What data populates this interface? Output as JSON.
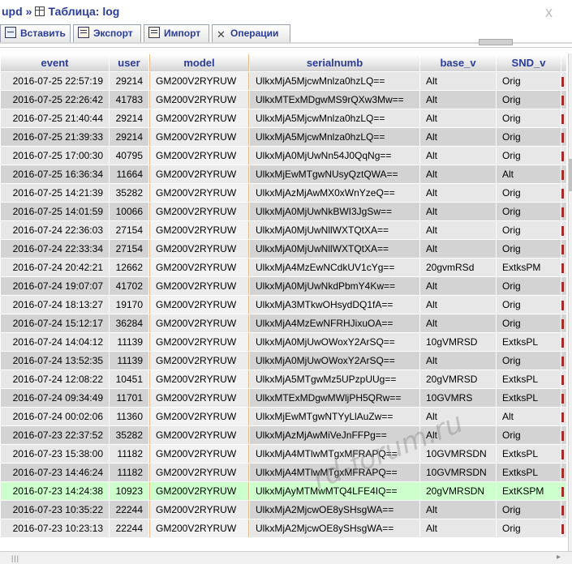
{
  "breadcrumb": {
    "db": "upd",
    "separator": "»",
    "table": "Таблица: log",
    "close": "x"
  },
  "tabs": [
    {
      "label": "Вставить",
      "icon": "insert-icon"
    },
    {
      "label": "Экспорт",
      "icon": "export-icon"
    },
    {
      "label": "Импорт",
      "icon": "import-icon"
    },
    {
      "label": "Операции",
      "icon": "operations-icon"
    }
  ],
  "table": {
    "columns": [
      "event",
      "user",
      "model",
      "serialnumb",
      "base_v",
      "SND_v"
    ],
    "rows": [
      [
        "2016-07-25 22:57:19",
        "29214",
        "GM200V2RYRUW",
        "UlkxMjA5MjcwMnlza0hzLQ==",
        "Alt",
        "Orig"
      ],
      [
        "2016-07-25 22:26:42",
        "41783",
        "GM200V2RYRUW",
        "UlkxMTExMDgwMS9rQXw3Mw==",
        "Alt",
        "Orig"
      ],
      [
        "2016-07-25 21:40:44",
        "29214",
        "GM200V2RYRUW",
        "UlkxMjA5MjcwMnlza0hzLQ==",
        "Alt",
        "Orig"
      ],
      [
        "2016-07-25 21:39:33",
        "29214",
        "GM200V2RYRUW",
        "UlkxMjA5MjcwMnlza0hzLQ==",
        "Alt",
        "Orig"
      ],
      [
        "2016-07-25 17:00:30",
        "40795",
        "GM200V2RYRUW",
        "UlkxMjA0MjUwNn54J0QqNg==",
        "Alt",
        "Orig"
      ],
      [
        "2016-07-25 16:36:34",
        "11664",
        "GM200V2RYRUW",
        "UlkxMjEwMTgwNUsyQztQWA==",
        "Alt",
        "Alt"
      ],
      [
        "2016-07-25 14:21:39",
        "35282",
        "GM200V2RYRUW",
        "UlkxMjAzMjAwMX0xWnYzeQ==",
        "Alt",
        "Orig"
      ],
      [
        "2016-07-25 14:01:59",
        "10066",
        "GM200V2RYRUW",
        "UlkxMjA0MjUwNkBWI3JgSw==",
        "Alt",
        "Orig"
      ],
      [
        "2016-07-24 22:36:03",
        "27154",
        "GM200V2RYRUW",
        "UlkxMjA0MjUwNllWXTQtXA==",
        "Alt",
        "Orig"
      ],
      [
        "2016-07-24 22:33:34",
        "27154",
        "GM200V2RYRUW",
        "UlkxMjA0MjUwNllWXTQtXA==",
        "Alt",
        "Orig"
      ],
      [
        "2016-07-24 20:42:21",
        "12662",
        "GM200V2RYRUW",
        "UlkxMjA4MzEwNCdkUV1cYg==",
        "20gvmRSd",
        "ExtksPM"
      ],
      [
        "2016-07-24 19:07:07",
        "41702",
        "GM200V2RYRUW",
        "UlkxMjA0MjUwNkdPbmY4Kw==",
        "Alt",
        "Orig"
      ],
      [
        "2016-07-24 18:13:27",
        "19170",
        "GM200V2RYRUW",
        "UlkxMjA3MTkwOHsydDQ1fA==",
        "Alt",
        "Orig"
      ],
      [
        "2016-07-24 15:12:17",
        "36284",
        "GM200V2RYRUW",
        "UlkxMjA4MzEwNFRHJixuOA==",
        "Alt",
        "Orig"
      ],
      [
        "2016-07-24 14:04:12",
        "11139",
        "GM200V2RYRUW",
        "UlkxMjA0MjUwOWoxY2ArSQ==",
        "10gVMRSD",
        "ExtksPL"
      ],
      [
        "2016-07-24 13:52:35",
        "11139",
        "GM200V2RYRUW",
        "UlkxMjA0MjUwOWoxY2ArSQ==",
        "Alt",
        "Orig"
      ],
      [
        "2016-07-24 12:08:22",
        "10451",
        "GM200V2RYRUW",
        "UlkxMjA5MTgwMz5UPzpUUg==",
        "20gVMRSD",
        "ExtksPL"
      ],
      [
        "2016-07-24 09:34:49",
        "11701",
        "GM200V2RYRUW",
        "UlkxMTExMDgwMWljPH5QRw==",
        "10GVMRS",
        "ExtksPL"
      ],
      [
        "2016-07-24 00:02:06",
        "11360",
        "GM200V2RYRUW",
        "UlkxMjEwMTgwNTYyLlAuZw==",
        "Alt",
        "Alt"
      ],
      [
        "2016-07-23 22:37:52",
        "35282",
        "GM200V2RYRUW",
        "UlkxMjAzMjAwMiVeJnFFPg==",
        "Alt",
        "Orig"
      ],
      [
        "2016-07-23 15:38:00",
        "11182",
        "GM200V2RYRUW",
        "UlkxMjA4MTlwMTgxMFRAPQ==",
        "10GVMRSDN",
        "ExtksPL"
      ],
      [
        "2016-07-23 14:46:24",
        "11182",
        "GM200V2RYRUW",
        "UlkxMjA4MTlwMTgxMFRAPQ==",
        "10GVMRSDN",
        "ExtksPL"
      ],
      [
        "2016-07-23 14:24:38",
        "10923",
        "GM200V2RYRUW",
        "UlkxMjAyMTMwMTQ4LFE4IQ==",
        "20gVMRSDN",
        "ExtKSPM"
      ],
      [
        "2016-07-23 10:35:22",
        "22244",
        "GM200V2RYRUW",
        "UlkxMjA2MjcwOE8ySHsgWA==",
        "Alt",
        "Orig"
      ],
      [
        "2016-07-23 10:23:13",
        "22244",
        "GM200V2RYRUW",
        "UlkxMjA2MjcwOE8ySHsgWA==",
        "Alt",
        "Orig"
      ]
    ],
    "highlighted_row": 22
  },
  "watermark": "rd-forum.ru",
  "colors": {
    "link": "#2a3c9a",
    "row_odd": "#e7e7e7",
    "row_even": "#d3d3d3",
    "row_highlight": "#ccffcc",
    "model_border": "#e9b98c"
  }
}
